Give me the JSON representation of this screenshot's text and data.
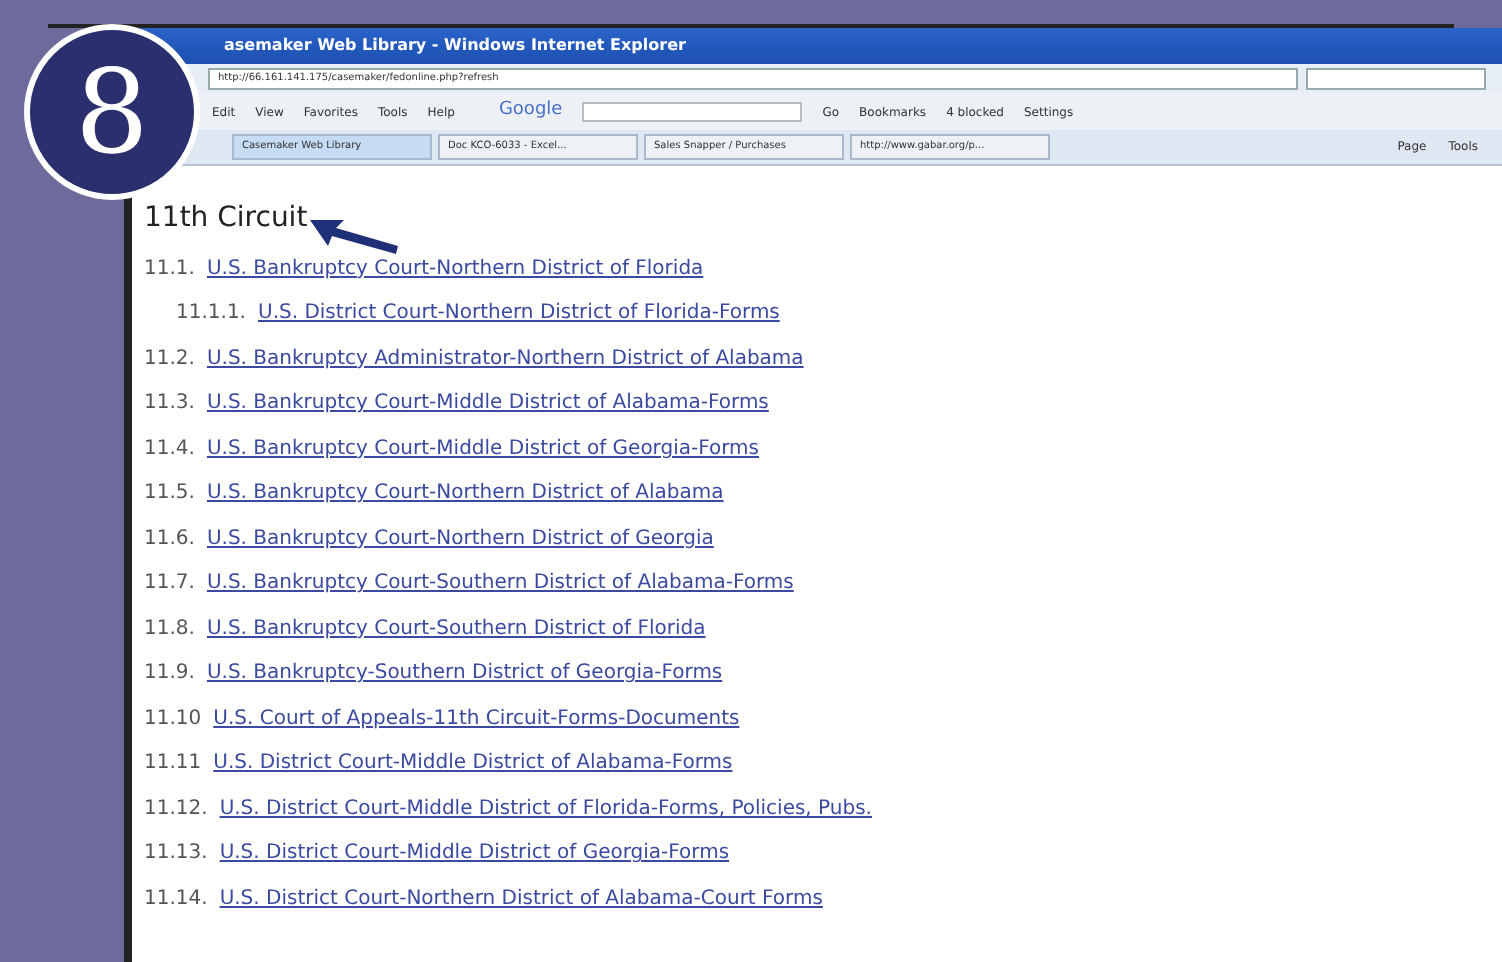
{
  "badge": "8",
  "window": {
    "title": "asemaker Web Library - Windows Internet Explorer"
  },
  "address_bar": {
    "value": "http://66.161.141.175/casemaker/fedonline.php?refresh"
  },
  "menu": [
    "Edit",
    "View",
    "Favorites",
    "Tools",
    "Help"
  ],
  "google_toolbar": {
    "logo": "Google",
    "go": "Go",
    "items": [
      "Bookmarks",
      "4 blocked",
      "Settings"
    ]
  },
  "tabs": [
    {
      "label": "Casemaker Web Library",
      "selected": true
    },
    {
      "label": "Doc KCO-6033 - Excel...",
      "selected": false
    },
    {
      "label": "Sales Snapper / Purchases",
      "selected": false
    },
    {
      "label": "http://www.gabar.org/p...",
      "selected": false
    }
  ],
  "command_bar": [
    "Page",
    "Tools"
  ],
  "heading": "11th Circuit",
  "links": [
    {
      "number": "11.1.",
      "text": "U.S. Bankruptcy Court-Northern District of Florida",
      "children": [
        {
          "number": "11.1.1.",
          "text": "U.S. District Court-Northern District of Florida-Forms"
        }
      ]
    },
    {
      "number": "11.2.",
      "text": "U.S. Bankruptcy Administrator-Northern District of Alabama"
    },
    {
      "number": "11.3.",
      "text": "U.S. Bankruptcy Court-Middle District of Alabama-Forms"
    },
    {
      "number": "11.4.",
      "text": "U.S. Bankruptcy Court-Middle District of Georgia-Forms"
    },
    {
      "number": "11.5.",
      "text": "U.S. Bankruptcy Court-Northern District of Alabama"
    },
    {
      "number": "11.6.",
      "text": "U.S. Bankruptcy Court-Northern District of Georgia"
    },
    {
      "number": "11.7.",
      "text": "U.S. Bankruptcy Court-Southern District of Alabama-Forms"
    },
    {
      "number": "11.8.",
      "text": "U.S. Bankruptcy Court-Southern District of Florida"
    },
    {
      "number": "11.9.",
      "text": "U.S. Bankruptcy-Southern District of Georgia-Forms"
    },
    {
      "number": "11.10",
      "text": "U.S. Court of Appeals-11th Circuit-Forms-Documents"
    },
    {
      "number": "11.11",
      "text": "U.S. District Court-Middle District of Alabama-Forms"
    },
    {
      "number": "11.12.",
      "text": "U.S. District Court-Middle District of Florida-Forms, Policies, Pubs."
    },
    {
      "number": "11.13.",
      "text": "U.S. District Court-Middle District of Georgia-Forms"
    },
    {
      "number": "11.14.",
      "text": "U.S. District Court-Northern District of Alabama-Court Forms"
    }
  ]
}
